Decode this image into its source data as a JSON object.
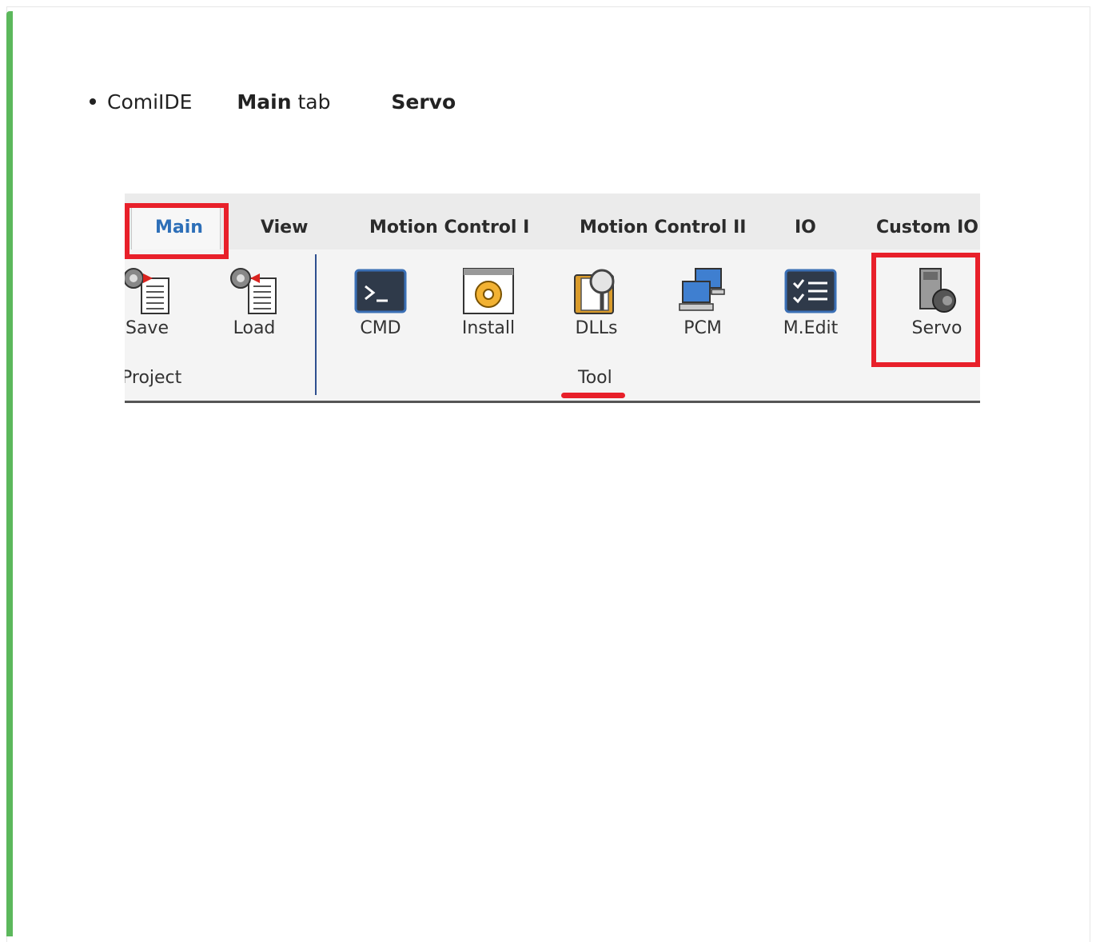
{
  "instruction": {
    "app_name": "ComiIDE",
    "tab_name": "Main",
    "tab_word": "tab",
    "button_name": "Servo"
  },
  "ribbon": {
    "tabs": [
      "Main",
      "View",
      "Motion Control I",
      "Motion Control II",
      "IO",
      "Custom IO"
    ],
    "groups": {
      "project": {
        "label": "Project",
        "buttons": [
          "Save",
          "Load"
        ]
      },
      "tool": {
        "label": "Tool",
        "buttons": [
          "CMD",
          "Install",
          "DLLs",
          "PCM",
          "M.Edit",
          "Servo"
        ]
      }
    }
  },
  "colors": {
    "accent_green": "#5cb85c",
    "highlight_red": "#e8202a",
    "active_tab_text": "#2d6fb8"
  }
}
